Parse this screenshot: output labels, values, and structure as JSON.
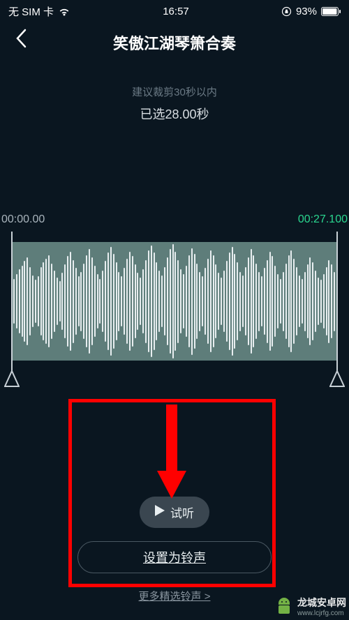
{
  "status": {
    "sim": "无 SIM 卡",
    "time": "16:57",
    "battery": "93%"
  },
  "header": {
    "title": "笑傲江湖琴箫合奏"
  },
  "editor": {
    "hint": "建议裁剪30秒以内",
    "selected": "已选28.00秒",
    "start_time": "00:00.00",
    "end_time": "00:27.100"
  },
  "actions": {
    "play_label": "试听",
    "set_ringtone_label": "设置为铃声",
    "more_label": "更多精选铃声 >"
  },
  "watermark": {
    "line1": "龙城安卓网",
    "line2": "www.lcjrfg.com"
  },
  "chart_data": {
    "type": "area",
    "title": "Audio waveform",
    "x_range_sec": [
      0,
      27.1
    ],
    "amplitude_percent": [
      38,
      46,
      54,
      60,
      68,
      74,
      58,
      44,
      36,
      42,
      58,
      66,
      72,
      78,
      64,
      52,
      40,
      34,
      48,
      62,
      76,
      84,
      70,
      56,
      42,
      50,
      64,
      78,
      88,
      74,
      60,
      46,
      38,
      52,
      68,
      82,
      92,
      80,
      66,
      50,
      42,
      56,
      72,
      84,
      76,
      62,
      48,
      40,
      54,
      70,
      86,
      94,
      82,
      66,
      52,
      44,
      58,
      74,
      88,
      96,
      84,
      70,
      54,
      46,
      60,
      78,
      90,
      80,
      64,
      50,
      42,
      56,
      72,
      86,
      78,
      62,
      48,
      40,
      52,
      68,
      82,
      92,
      80,
      66,
      50,
      44,
      58,
      74,
      88,
      78,
      64,
      50,
      42,
      56,
      70,
      84,
      76,
      60,
      46,
      38,
      50,
      64,
      78,
      86,
      72,
      58,
      44,
      38,
      50,
      62,
      74,
      66,
      52,
      40,
      36,
      46,
      58,
      70,
      62,
      50
    ]
  }
}
